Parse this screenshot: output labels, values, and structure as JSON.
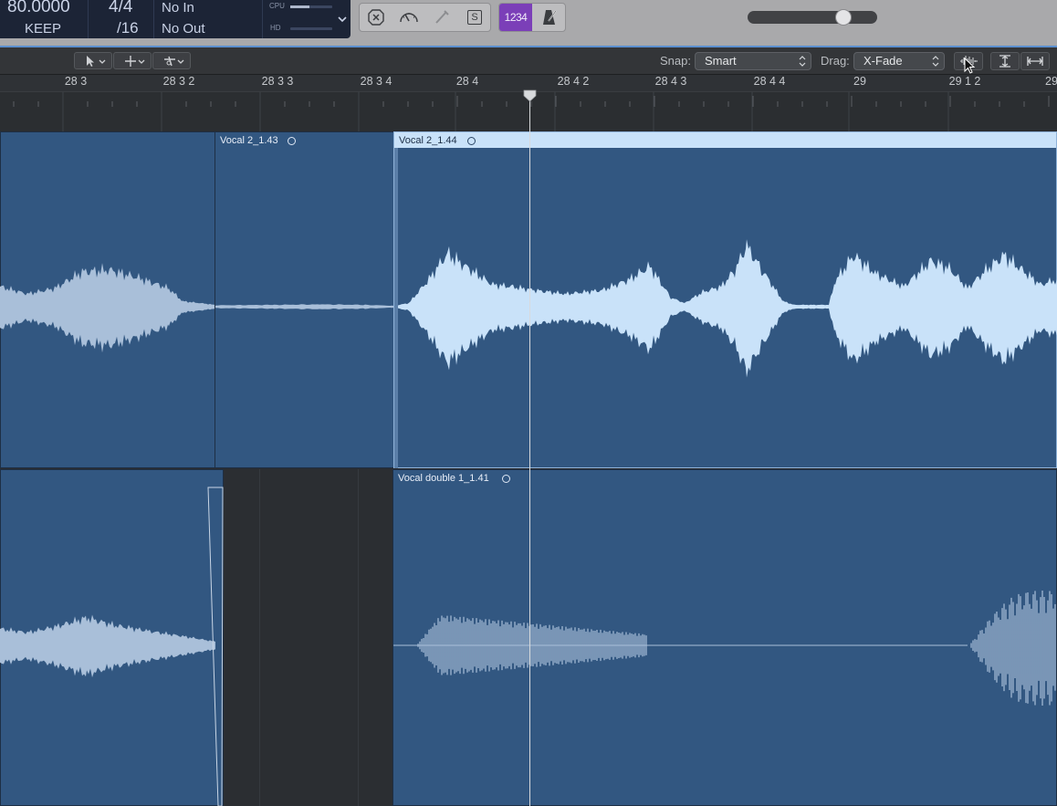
{
  "lcd": {
    "tempo": "80.0000",
    "key": "KEEP",
    "time_signature": "4/4",
    "division": "/16",
    "in_point": "No In",
    "out_point": "No Out",
    "cpu_label": "CPU",
    "hd_label": "HD",
    "cpu_level": 0.45,
    "hd_level": 0.0
  },
  "toolbar_buttons": {
    "replace_icon": "x-circle-icon",
    "tuning_icon": "gauge-icon",
    "autopunch_icon": "pen-disabled-icon",
    "solo_label": "S",
    "count_in_label": "1234",
    "metronome_icon": "metronome-icon",
    "accent_color": "#7b3fb8"
  },
  "master_volume": {
    "level": 0.74
  },
  "tools": {
    "pointer_tool_icon": "pointer-icon",
    "marquee_tool_icon": "crosshair-icon",
    "scissors_tool_icon": "scissors-icon",
    "snap_label": "Snap:",
    "snap_value": "Smart",
    "drag_label": "Drag:",
    "drag_value": "X-Fade",
    "waveform_zoom_icon": "waveform-zoom-icon",
    "vertical_zoom_icon": "vertical-fit-icon",
    "horizontal_zoom_icon": "horizontal-fit-icon"
  },
  "ruler": {
    "labels": [
      "28 3",
      "28 3 2",
      "28 3 3",
      "28 3 4",
      "28 4",
      "28 4 2",
      "28 4 3",
      "28 4 4",
      "29",
      "29 1 2",
      "29"
    ]
  },
  "tracks": [
    {
      "regions": [
        {
          "name": "",
          "selected": false
        },
        {
          "name": "Vocal 2_1.43",
          "selected": false
        },
        {
          "name": "Vocal 2_1.44",
          "selected": true
        }
      ]
    },
    {
      "regions": [
        {
          "name": "",
          "selected": false
        },
        {
          "name": "Vocal  double 1_1.41",
          "selected": false
        }
      ]
    }
  ],
  "colors": {
    "region_fill": "#325781",
    "waveform": "#a9bfd9",
    "waveform_selected": "#c9e2f9",
    "selected_header": "#c9e2f9",
    "playhead": "#d8dadc"
  }
}
